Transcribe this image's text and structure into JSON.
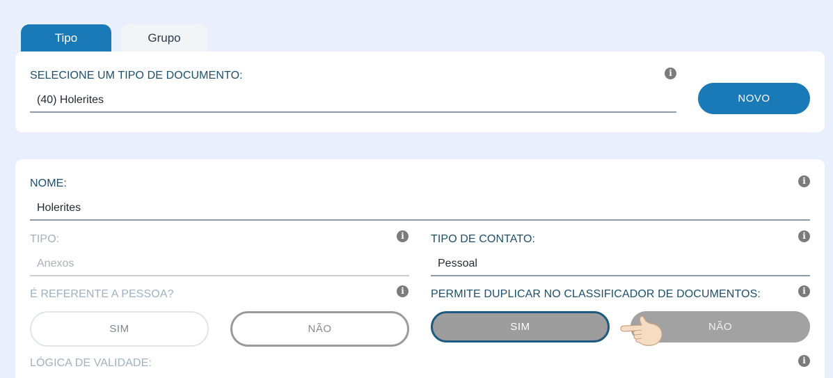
{
  "tabs": {
    "tipo": "Tipo",
    "grupo": "Grupo"
  },
  "top": {
    "label": "SELECIONE UM TIPO DE DOCUMENTO:",
    "value": "(40) Holerites",
    "novo_button": "NOVO"
  },
  "main": {
    "nome": {
      "label": "NOME:",
      "value": "Holerites"
    },
    "tipo": {
      "label": "TIPO:",
      "placeholder": "Anexos"
    },
    "tipo_contato": {
      "label": "TIPO DE CONTATO:",
      "value": "Pessoal"
    },
    "referente": {
      "label": "É REFERENTE A PESSOA?",
      "sim": "SIM",
      "nao": "NÃO"
    },
    "duplicar": {
      "label": "PERMITE DUPLICAR NO CLASSIFICADOR DE DOCUMENTOS:",
      "sim": "SIM",
      "nao": "NÃO"
    },
    "validade": {
      "label": "LÓGICA DE VALIDADE:"
    }
  },
  "icons": {
    "info": "info-icon",
    "pointer": "pointing-hand-icon"
  },
  "colors": {
    "accent": "#1a7ab8",
    "background": "#e9effd",
    "label": "#1c4f6b"
  }
}
